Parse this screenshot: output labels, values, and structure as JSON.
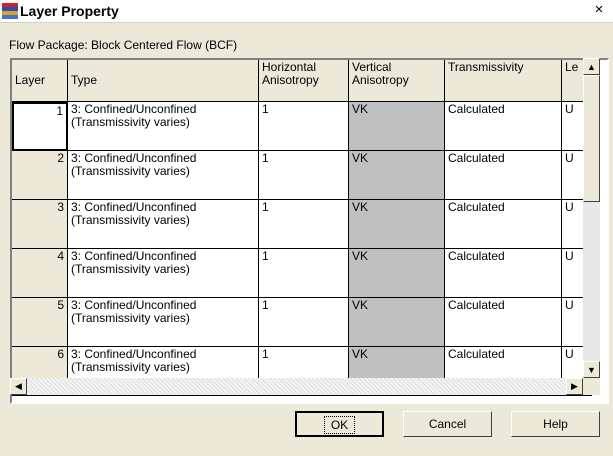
{
  "window": {
    "title": "Layer Property",
    "close_symbol": "×"
  },
  "package_label": "Flow Package: Block Centered Flow (BCF)",
  "grid": {
    "columns": [
      "Layer",
      "Type",
      "Horizontal\nAnisotropy",
      "Vertical\nAnisotropy",
      "Transmissivity",
      "Le"
    ],
    "rows": [
      {
        "layer": "1",
        "type": "3: Confined/Unconfined\n(Transmissivity varies)",
        "horiz": "1",
        "vert": "VK",
        "trans": "Calculated",
        "le": "U"
      },
      {
        "layer": "2",
        "type": "3: Confined/Unconfined\n(Transmissivity varies)",
        "horiz": "1",
        "vert": "VK",
        "trans": "Calculated",
        "le": "U"
      },
      {
        "layer": "3",
        "type": "3: Confined/Unconfined\n(Transmissivity varies)",
        "horiz": "1",
        "vert": "VK",
        "trans": "Calculated",
        "le": "U"
      },
      {
        "layer": "4",
        "type": "3: Confined/Unconfined\n(Transmissivity varies)",
        "horiz": "1",
        "vert": "VK",
        "trans": "Calculated",
        "le": "U"
      },
      {
        "layer": "5",
        "type": "3: Confined/Unconfined\n(Transmissivity varies)",
        "horiz": "1",
        "vert": "VK",
        "trans": "Calculated",
        "le": "U"
      },
      {
        "layer": "6",
        "type": "3: Confined/Unconfined\n(Transmissivity varies)",
        "horiz": "1",
        "vert": "VK",
        "trans": "Calculated",
        "le": "U"
      }
    ]
  },
  "buttons": {
    "ok": "OK",
    "cancel": "Cancel",
    "help": "Help"
  },
  "scroll_icons": {
    "up": "▲",
    "down": "▼",
    "left": "◀",
    "right": "▶"
  },
  "colors": {
    "disabled_cell": "#C0C0C0",
    "dialog_bg": "#ECE9D8"
  }
}
